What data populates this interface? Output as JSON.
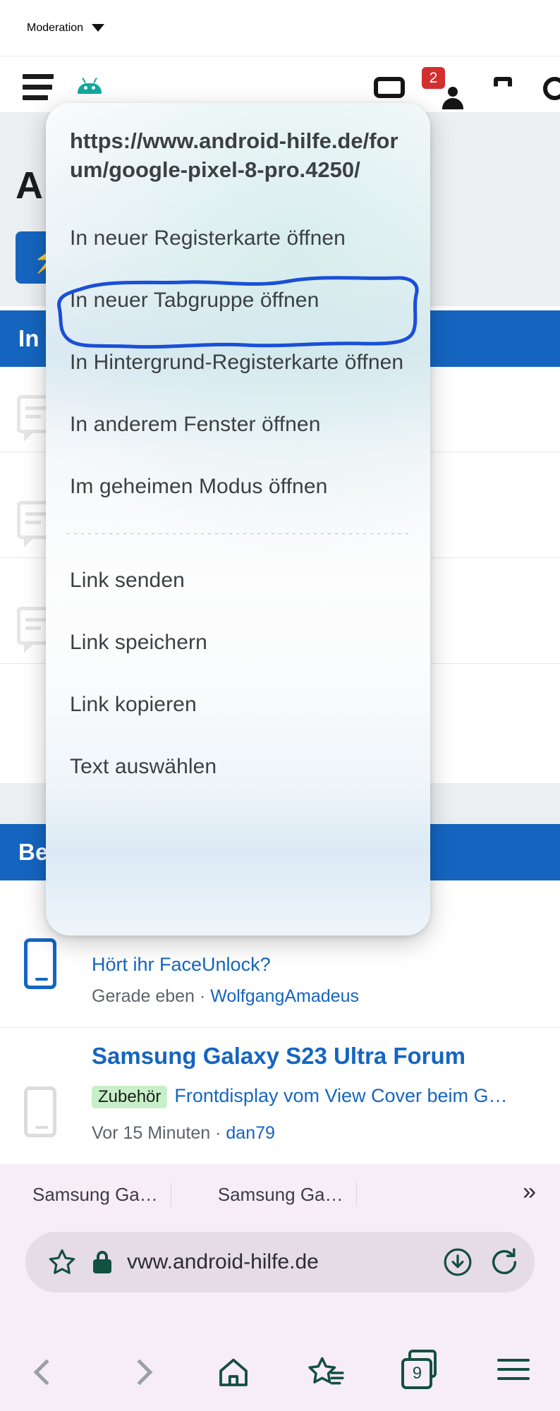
{
  "moderation": {
    "label": "Moderation",
    "caret_icon": "chevron-down-icon"
  },
  "site_header": {
    "menu_icon": "hamburger-menu-icon",
    "logo_icon": "android-robot-icon",
    "conversations_icon": "chat-icon",
    "alerts_icon": "person-icon",
    "alerts_badge": "2",
    "share_icon": "share-icon",
    "search_icon": "search-icon"
  },
  "page_background": {
    "heading": "A",
    "chip_icon": "lightning-bolt-icon",
    "section_bars": [
      {
        "label": "In"
      },
      {
        "label": "Be"
      }
    ],
    "threads": [
      {
        "icon": "phone-outline-icon",
        "title": "Hört ihr FaceUnlock?",
        "time": "Gerade eben",
        "separator": "·",
        "user": "WolfgangAmadeus"
      }
    ],
    "forum": {
      "icon": "phone-outline-icon",
      "title": "Samsung Galaxy S23 Ultra Forum",
      "tag": "Zubehör",
      "thread_title": "Frontdisplay vom View Cover beim G…",
      "time": "Vor 15 Minuten",
      "separator": "·",
      "user": "dan79"
    }
  },
  "context_menu": {
    "url": "https://www.android-hilfe.de/forum/google-pixel-8-pro.4250/",
    "items": [
      {
        "label": "In neuer Registerkarte öffnen",
        "highlighted": false
      },
      {
        "label": "In neuer Tabgruppe öffnen",
        "highlighted": false
      },
      {
        "label": "In Hintergrund-Registerkarte öffnen",
        "highlighted": true
      },
      {
        "label": "In anderem Fenster öffnen",
        "highlighted": false
      },
      {
        "label": "Im geheimen Modus öffnen",
        "highlighted": false
      }
    ],
    "items_after_divider": [
      {
        "label": "Link senden"
      },
      {
        "label": "Link speichern"
      },
      {
        "label": "Link kopieren"
      },
      {
        "label": "Text auswählen"
      }
    ],
    "annotation_color": "#1a4fd6"
  },
  "browser_chrome": {
    "tabs": [
      {
        "title": "Samsung Ga…"
      },
      {
        "title": "Samsung Ga…"
      }
    ],
    "tabs_more_icon": "chevron-double-right-icon",
    "tabs_more_label": "»",
    "address_bar": {
      "bookmark_icon": "star-icon",
      "security_icon": "lock-icon",
      "url": "vww.android-hilfe.de",
      "download_icon": "download-circle-icon",
      "reload_icon": "reload-icon"
    },
    "nav": {
      "back_icon": "chevron-left-icon",
      "forward_icon": "chevron-right-icon",
      "home_icon": "home-icon",
      "bookmarks_icon": "star-list-icon",
      "tabs_icon": "tab-stack-icon",
      "tab_count": "9",
      "menu_icon": "hamburger-menu-icon"
    }
  },
  "colors": {
    "brand_blue": "#1565c0",
    "badge_red": "#d32f2f",
    "chrome_bg": "#f7edf7",
    "annotation": "#1a4fd6",
    "tag_green": "#c8f0c8",
    "chrome_teal": "#14503f"
  }
}
